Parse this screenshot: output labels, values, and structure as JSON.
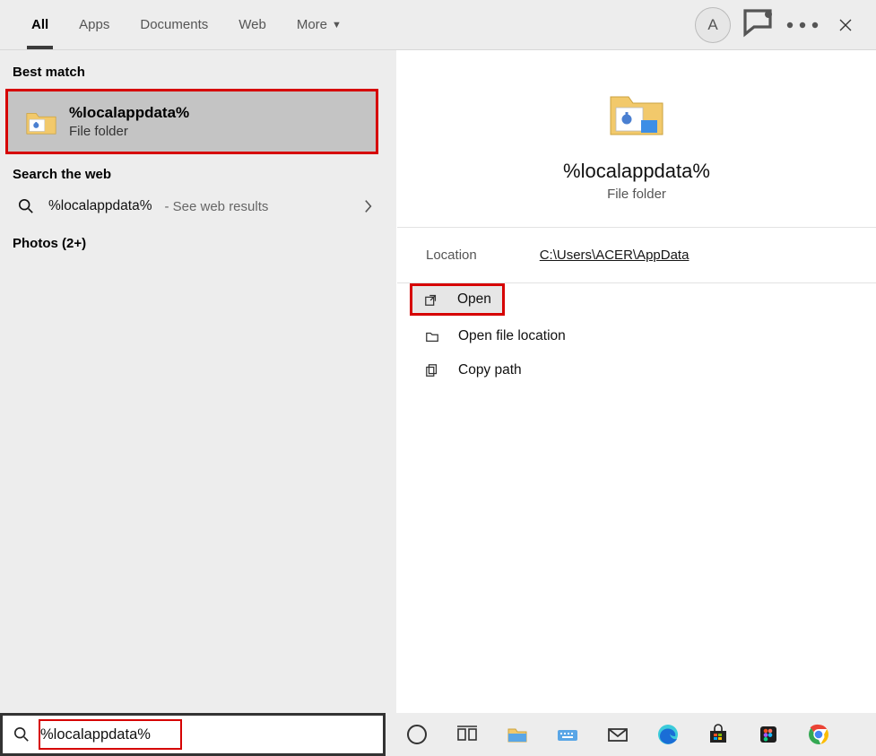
{
  "header": {
    "tabs": [
      "All",
      "Apps",
      "Documents",
      "Web",
      "More"
    ],
    "active_index": 0,
    "avatar_letter": "A"
  },
  "left": {
    "best_match_label": "Best match",
    "best_match": {
      "title": "%localappdata%",
      "subtitle": "File folder"
    },
    "search_web_label": "Search the web",
    "web_result": {
      "query": "%localappdata%",
      "suffix": " - See web results"
    },
    "photos_label": "Photos (2+)"
  },
  "details": {
    "title": "%localappdata%",
    "subtitle": "File folder",
    "location_label": "Location",
    "location_value": "C:\\Users\\ACER\\AppData",
    "actions": {
      "open": "Open",
      "open_file_location": "Open file location",
      "copy_path": "Copy path"
    }
  },
  "search": {
    "value": "%localappdata%"
  },
  "taskbar": {
    "icons": [
      "cortana-icon",
      "task-view-icon",
      "file-explorer-icon",
      "keyboard-icon",
      "mail-icon",
      "edge-icon",
      "store-icon",
      "figma-icon",
      "chrome-icon"
    ]
  }
}
